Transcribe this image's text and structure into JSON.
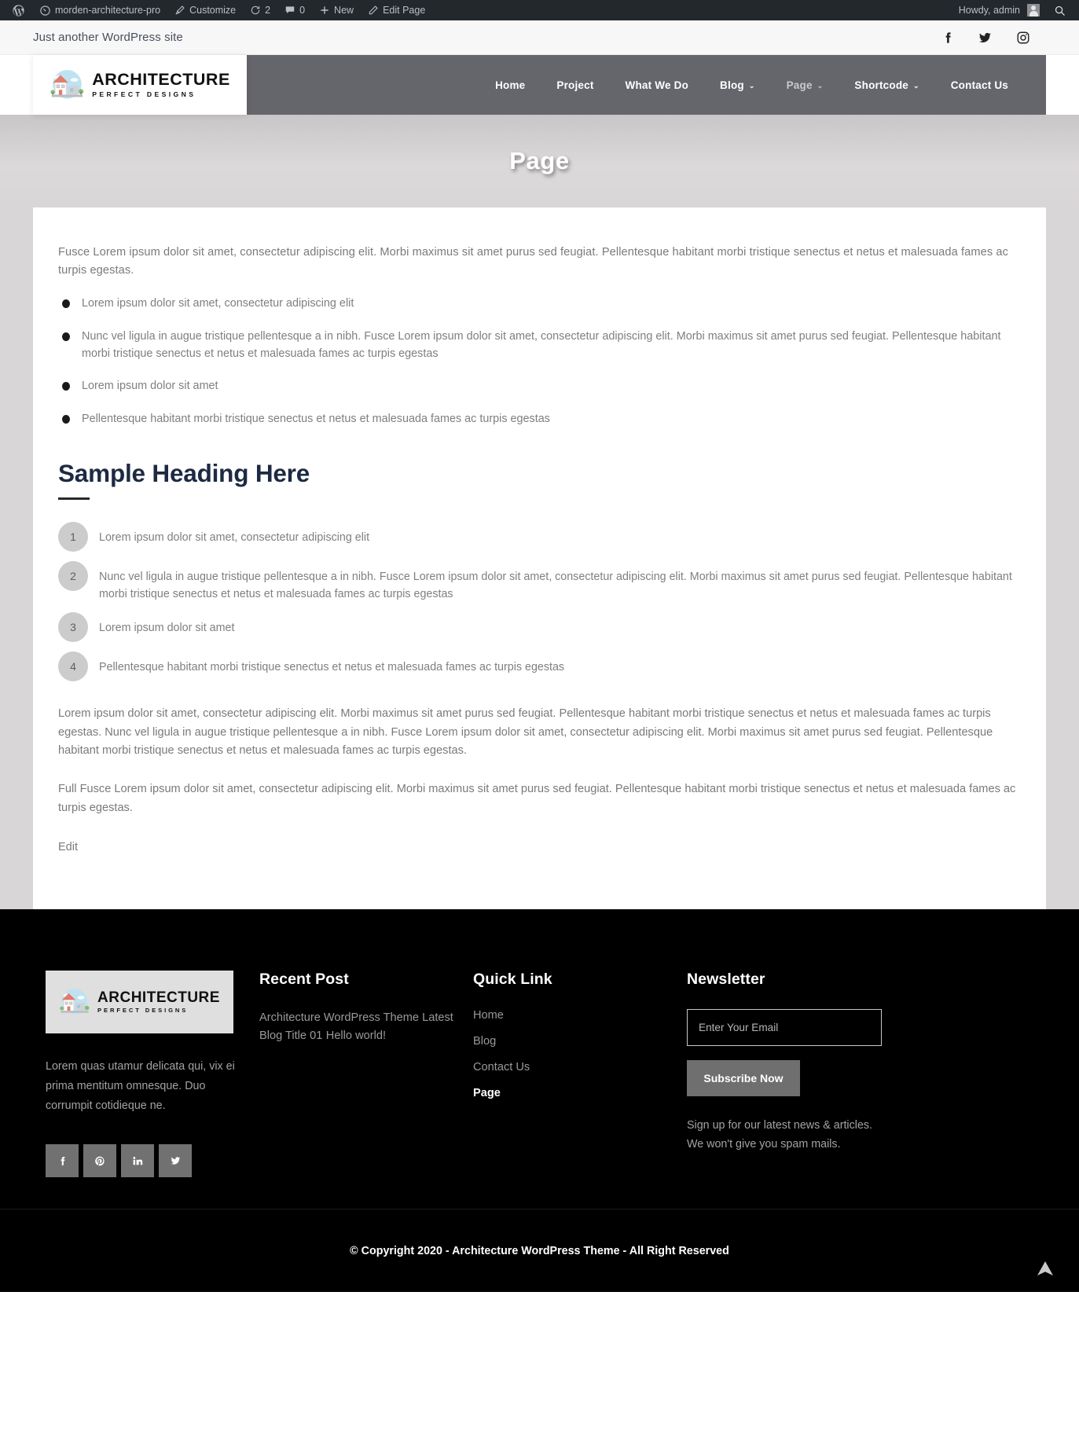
{
  "adminbar": {
    "site_name": "morden-architecture-pro",
    "customize": "Customize",
    "revisions_count": "2",
    "comments_count": "0",
    "new": "New",
    "edit_page": "Edit Page",
    "howdy": "Howdy, admin",
    "wp_logo_icon": "wordpress-logo-icon",
    "dashboard_icon": "dashboard-icon",
    "customize_icon": "paintbrush-icon",
    "revisions_icon": "refresh-icon",
    "comments_icon": "comment-bubble-icon",
    "new_icon": "plus-icon",
    "edit_icon": "pencil-icon",
    "avatar_icon": "user-avatar-icon",
    "search_icon": "search-icon"
  },
  "topbar": {
    "tagline": "Just another WordPress site",
    "socials": [
      {
        "name": "facebook-icon",
        "label": "Facebook"
      },
      {
        "name": "twitter-icon",
        "label": "Twitter"
      },
      {
        "name": "instagram-icon",
        "label": "Instagram"
      }
    ]
  },
  "brand": {
    "logo_icon": "architecture-house-logo-icon",
    "title": "ARCHITECTURE",
    "subtitle": "PERFECT DESIGNS"
  },
  "nav": {
    "items": [
      {
        "label": "Home",
        "has_dropdown": false,
        "current": false
      },
      {
        "label": "Project",
        "has_dropdown": false,
        "current": false
      },
      {
        "label": "What We Do",
        "has_dropdown": false,
        "current": false
      },
      {
        "label": "Blog",
        "has_dropdown": true,
        "current": false
      },
      {
        "label": "Page",
        "has_dropdown": true,
        "current": true
      },
      {
        "label": "Shortcode",
        "has_dropdown": true,
        "current": false
      },
      {
        "label": "Contact Us",
        "has_dropdown": false,
        "current": false
      }
    ],
    "caret": "⌄"
  },
  "banner": {
    "title": "Page"
  },
  "content": {
    "intro": "Fusce Lorem ipsum dolor sit amet, consectetur adipiscing elit. Morbi maximus sit amet purus sed feugiat. Pellentesque habitant morbi tristique senectus et netus et malesuada fames ac turpis egestas.",
    "bullets": [
      "Lorem ipsum dolor sit amet, consectetur adipiscing elit",
      "Nunc vel ligula in augue tristique pellentesque a in nibh. Fusce Lorem ipsum dolor sit amet, consectetur adipiscing elit. Morbi maximus sit amet purus sed feugiat. Pellentesque habitant morbi tristique senectus et netus et malesuada fames ac turpis egestas",
      "Lorem ipsum dolor sit amet",
      "Pellentesque habitant morbi tristique senectus et netus et malesuada fames ac turpis egestas"
    ],
    "heading": "Sample Heading Here",
    "numbered": [
      {
        "num": "1",
        "text": "Lorem ipsum dolor sit amet, consectetur adipiscing elit"
      },
      {
        "num": "2",
        "text": "Nunc vel ligula in augue tristique pellentesque a in nibh. Fusce Lorem ipsum dolor sit amet, consectetur adipiscing elit. Morbi maximus sit amet purus sed feugiat. Pellentesque habitant morbi tristique senectus et netus et malesuada fames ac turpis egestas"
      },
      {
        "num": "3",
        "text": "Lorem ipsum dolor sit amet"
      },
      {
        "num": "4",
        "text": "Pellentesque habitant morbi tristique senectus et netus et malesuada fames ac turpis egestas"
      }
    ],
    "paragraph_1": "Lorem ipsum dolor sit amet, consectetur adipiscing elit. Morbi maximus sit amet purus sed feugiat. Pellentesque habitant morbi tristique senectus et netus et malesuada fames ac turpis egestas. Nunc vel ligula in augue tristique pellentesque a in nibh. Fusce Lorem ipsum dolor sit amet, consectetur adipiscing elit. Morbi maximus sit amet purus sed feugiat. Pellentesque habitant morbi tristique senectus et netus et malesuada fames ac turpis egestas.",
    "paragraph_2": "Full Fusce Lorem ipsum dolor sit amet, consectetur adipiscing elit. Morbi maximus sit amet purus sed feugiat. Pellentesque habitant morbi tristique senectus et netus et malesuada fames ac turpis egestas.",
    "edit_link": "Edit"
  },
  "footer": {
    "about_text": "Lorem quas utamur delicata qui, vix ei prima mentitum omnesque. Duo corrumpit cotidieque ne.",
    "socials": [
      {
        "name": "facebook-icon",
        "label": "Facebook"
      },
      {
        "name": "pinterest-icon",
        "label": "Pinterest"
      },
      {
        "name": "linkedin-icon",
        "label": "LinkedIn"
      },
      {
        "name": "twitter-icon",
        "label": "Twitter"
      }
    ],
    "recent_post": {
      "title": "Recent Post",
      "items": [
        "Architecture WordPress Theme Latest Blog Title 01",
        "Hello world!"
      ]
    },
    "quick_link": {
      "title": "Quick Link",
      "items": [
        {
          "label": "Home",
          "active": false
        },
        {
          "label": "Blog",
          "active": false
        },
        {
          "label": "Contact Us",
          "active": false
        },
        {
          "label": "Page",
          "active": true
        }
      ]
    },
    "newsletter": {
      "title": "Newsletter",
      "placeholder": "Enter Your Email",
      "value": "",
      "button": "Subscribe Now",
      "note": "Sign up for our latest news & articles. We won't give you spam mails."
    }
  },
  "copyright": {
    "text": "© Copyright 2020 - Architecture WordPress Theme - All Right Reserved",
    "to_top_icon": "scroll-to-top-icon"
  },
  "colors": {
    "navbar": "#65666c",
    "heading": "#1d2a42",
    "footer_bg": "#000000",
    "accent_button": "#6f6f6f"
  }
}
